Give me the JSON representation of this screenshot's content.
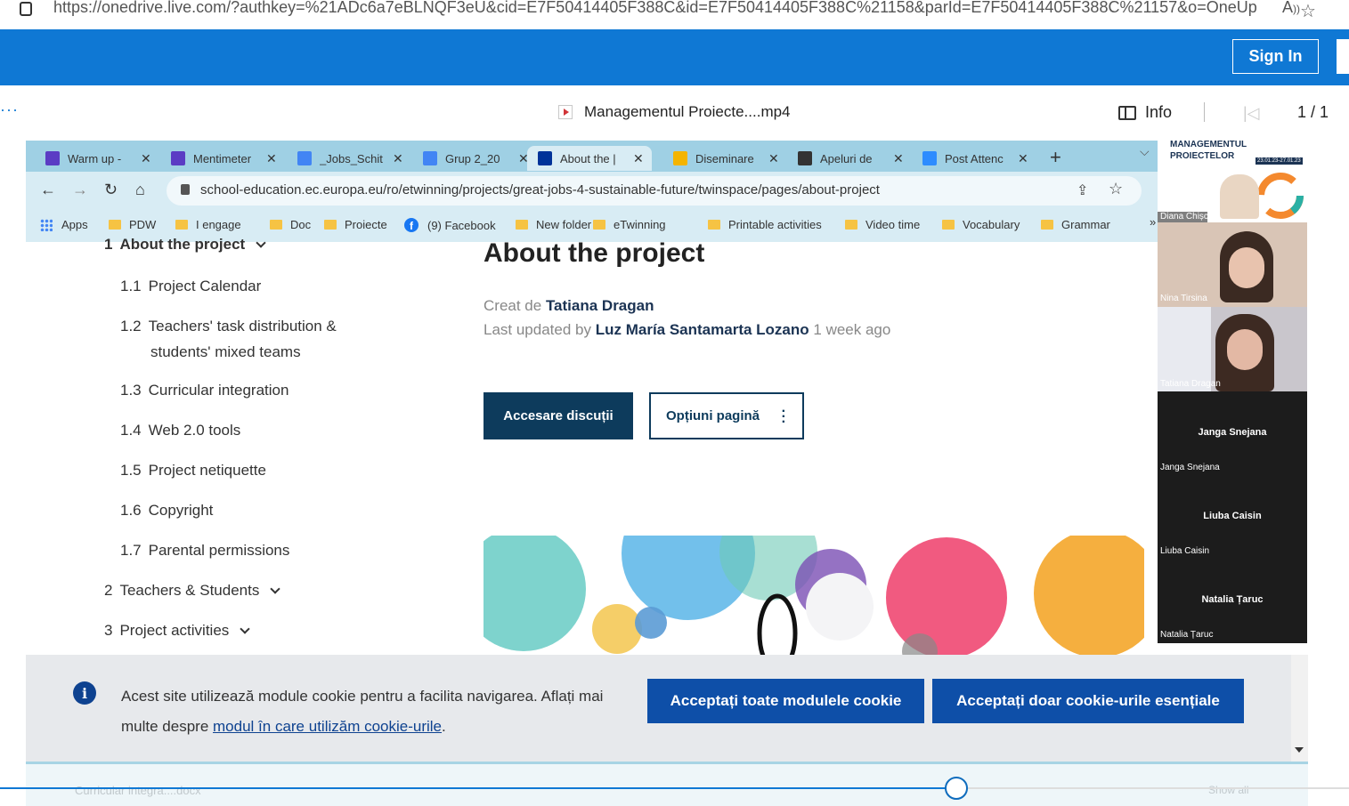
{
  "outer_browser": {
    "url": "https://onedrive.live.com/?authkey=%21ADc6a7eBLNQF3eU&cid=E7F50414405F388C&id=E7F50414405F388C%21158&parId=E7F50414405F388C%21157&o=OneUp"
  },
  "onedrive": {
    "sign_in_label": "Sign In",
    "more_icon": "more-icon",
    "file_name": "Managementul Proiecte....mp4",
    "info_label": "Info",
    "page_indicator": "1 / 1",
    "brand_color": "#0f78d4"
  },
  "video": {
    "progress_fraction": 0.709,
    "tabs": [
      {
        "label": "Warm up -",
        "icon_color": "#5b3cc4"
      },
      {
        "label": "Mentimeter",
        "icon_color": "#5b3cc4"
      },
      {
        "label": "_Jobs_Schit",
        "icon_color": "#4285f4"
      },
      {
        "label": "Grup 2_20",
        "icon_color": "#4285f4"
      },
      {
        "label": "About the |",
        "icon_color": "#003399"
      },
      {
        "label": "Diseminare",
        "icon_color": "#f4b400"
      },
      {
        "label": "Apeluri de",
        "icon_color": "#333333"
      },
      {
        "label": "Post Attenc",
        "icon_color": "#2d8cff"
      }
    ],
    "address_url": "school-education.ec.europa.eu/ro/etwinning/projects/great-jobs-4-sustainable-future/twinspace/pages/about-project",
    "bookmarks": [
      "Apps",
      "PDW",
      "I engage",
      "Doc",
      "Proiecte",
      "(9) Facebook",
      "New folder",
      "eTwinning",
      "Printable activities",
      "Video time",
      "Vocabulary",
      "Grammar"
    ],
    "bookmarks_more": "»",
    "toc": {
      "top_item": {
        "num": "1",
        "label": "About the project"
      },
      "sub_items": [
        {
          "num": "1.1",
          "label": "Project Calendar"
        },
        {
          "num": "1.2",
          "label": "Teachers' task distribution &",
          "label2": "students' mixed teams"
        },
        {
          "num": "1.3",
          "label": "Curricular integration"
        },
        {
          "num": "1.4",
          "label": "Web 2.0 tools"
        },
        {
          "num": "1.5",
          "label": "Project netiquette"
        },
        {
          "num": "1.6",
          "label": "Copyright"
        },
        {
          "num": "1.7",
          "label": "Parental permissions"
        }
      ],
      "sections": [
        {
          "num": "2",
          "label": "Teachers & Students"
        },
        {
          "num": "3",
          "label": "Project activities"
        }
      ]
    },
    "page_title": "About the project",
    "created_prefix": "Creat de",
    "created_by": "Tatiana Dragan",
    "updated_prefix": "Last updated by",
    "updated_by": "Luz María Santamarta Lozano",
    "updated_when": "1 week ago",
    "btn_discussions": "Accesare discuții",
    "btn_options": "Opțiuni pagină",
    "cookie": {
      "text_part1": "Acest site utilizează module cookie pentru a facilita navigarea. Aflați mai multe despre",
      "link": "modul în care utilizăm cookie-urile",
      "text_part2": ".",
      "accept_all": "Acceptați toate modulele cookie",
      "accept_essential": "Acceptați doar cookie-urile esențiale"
    },
    "download": {
      "file": "Curricular integra....docx",
      "show_all": "Show all"
    },
    "participants": {
      "slide_title_line1": "MANAGEMENTUL",
      "slide_title_line2": "PROIECTELOR",
      "slide_dates": "23.01.23-27.01.23",
      "video_tiles": [
        "Diana Chișca",
        "Nina Tirsina",
        "Tatiana Dragan"
      ],
      "audio_tiles": [
        {
          "center": "Janga Snejana",
          "name": "Janga Snejana"
        },
        {
          "center": "Liuba Caisin",
          "name": "Liuba Caisin"
        },
        {
          "center": "Natalia Țaruc",
          "name": "Natalia Țaruc"
        }
      ]
    }
  }
}
